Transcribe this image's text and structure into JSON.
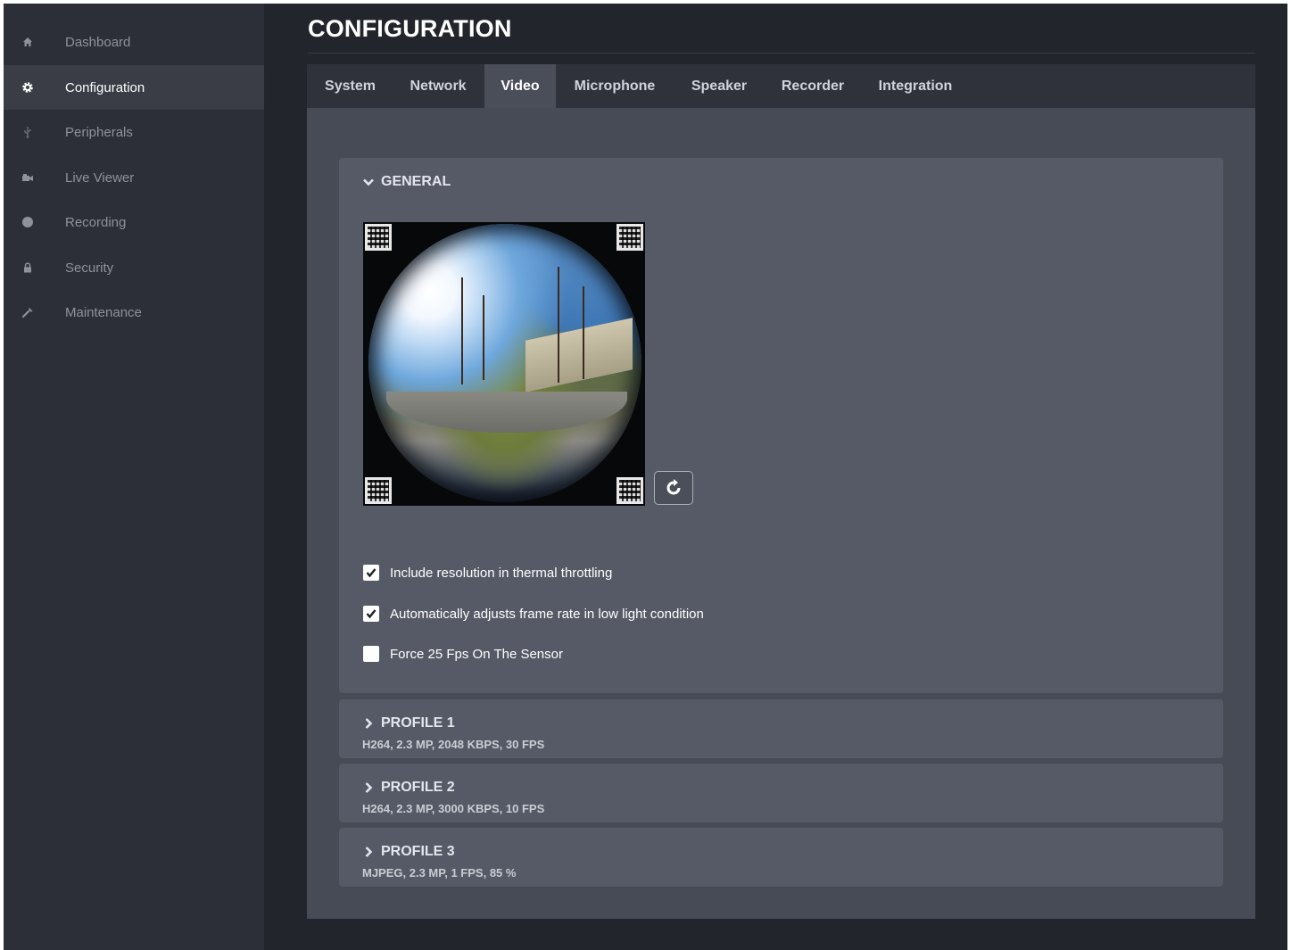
{
  "sidebar": {
    "items": [
      {
        "label": "Dashboard",
        "icon": "home-icon",
        "active": false
      },
      {
        "label": "Configuration",
        "icon": "gear-icon",
        "active": true
      },
      {
        "label": "Peripherals",
        "icon": "usb-icon",
        "active": false
      },
      {
        "label": "Live Viewer",
        "icon": "video-camera-icon",
        "active": false
      },
      {
        "label": "Recording",
        "icon": "record-icon",
        "active": false
      },
      {
        "label": "Security",
        "icon": "lock-icon",
        "active": false
      },
      {
        "label": "Maintenance",
        "icon": "wrench-icon",
        "active": false
      }
    ]
  },
  "header": {
    "title": "CONFIGURATION"
  },
  "tabs": [
    {
      "label": "System",
      "active": false
    },
    {
      "label": "Network",
      "active": false
    },
    {
      "label": "Video",
      "active": true
    },
    {
      "label": "Microphone",
      "active": false
    },
    {
      "label": "Speaker",
      "active": false
    },
    {
      "label": "Recorder",
      "active": false
    },
    {
      "label": "Integration",
      "active": false
    }
  ],
  "general": {
    "title": "GENERAL",
    "expanded": true,
    "options": [
      {
        "label": "Include resolution in thermal throttling",
        "checked": true
      },
      {
        "label": "Automatically adjusts frame rate in low light condition",
        "checked": true
      },
      {
        "label": "Force 25 Fps On The Sensor",
        "checked": false
      }
    ]
  },
  "profiles": [
    {
      "title": "PROFILE 1",
      "summary": "H264, 2.3 MP, 2048 KBPS, 30 FPS"
    },
    {
      "title": "PROFILE 2",
      "summary": "H264, 2.3 MP, 3000 KBPS, 10 FPS"
    },
    {
      "title": "PROFILE 3",
      "summary": "MJPEG, 2.3 MP, 1 FPS, 85 %"
    }
  ],
  "colors": {
    "background": "#23252d",
    "sidebar": "#2c2f37",
    "panel": "#565a66",
    "content": "#474b55",
    "text_muted": "#8e929b"
  }
}
